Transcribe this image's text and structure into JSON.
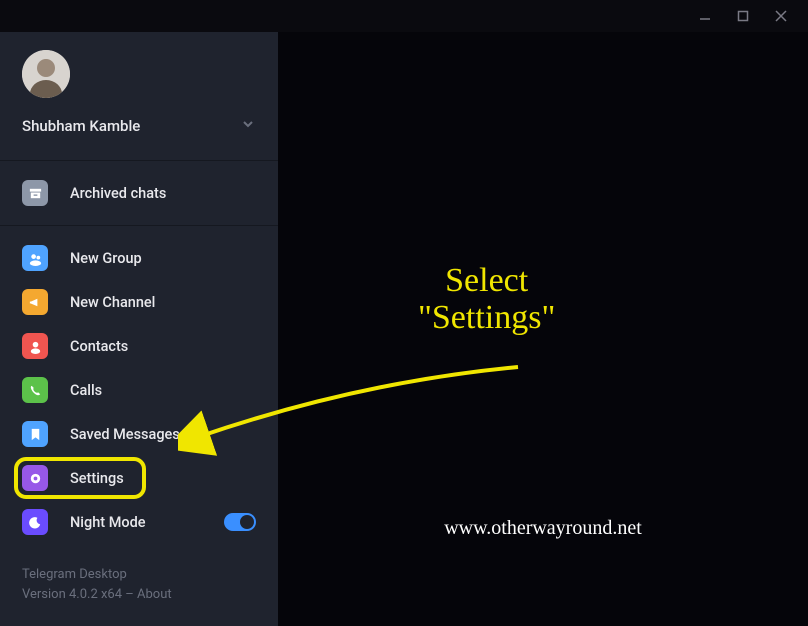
{
  "profile": {
    "name": "Shubham Kamble"
  },
  "menu": {
    "archived": "Archived chats",
    "new_group": "New Group",
    "new_channel": "New Channel",
    "contacts": "Contacts",
    "calls": "Calls",
    "saved_messages": "Saved Messages",
    "settings": "Settings",
    "night_mode": "Night Mode"
  },
  "footer": {
    "app_name": "Telegram Desktop",
    "version_line": "Version 4.0.2 x64 – About"
  },
  "annotation": {
    "line1": "Select",
    "line2": "\"Settings\""
  },
  "watermark": "www.otherwayround.net",
  "colors": {
    "archived": "#8d97a8",
    "new_group": "#4fa3ff",
    "new_channel": "#f4a830",
    "contacts": "#f05550",
    "calls": "#5cc24a",
    "saved_messages": "#4fa3ff",
    "settings": "#9758e8",
    "night_mode": "#6a4cff"
  }
}
